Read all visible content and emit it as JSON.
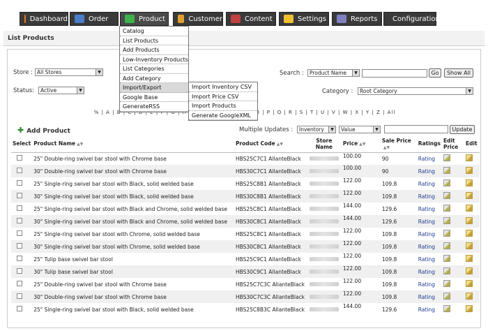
{
  "nav": {
    "tabs": [
      {
        "label": "Dashboard",
        "icon": "dashboard-icon",
        "color": "#e87722"
      },
      {
        "label": "Order",
        "icon": "order-icon",
        "color": "#4a7fc8"
      },
      {
        "label": "Product",
        "icon": "product-icon",
        "color": "#3cb44a"
      },
      {
        "label": "Customer",
        "icon": "customer-icon",
        "color": "#e0a030"
      },
      {
        "label": "Content",
        "icon": "content-icon",
        "color": "#c04040"
      },
      {
        "label": "Settings",
        "icon": "settings-icon",
        "color": "#f0c030"
      },
      {
        "label": "Reports",
        "icon": "reports-icon",
        "color": "#8080c0"
      },
      {
        "label": "Configuration",
        "icon": "configuration-icon",
        "color": "#a0a0a0"
      }
    ]
  },
  "page_title": "List Products",
  "filters": {
    "store_label": "Store :",
    "store_value": "All Stores",
    "status_label": "Status:",
    "status_value": "Active",
    "search_label": "Search :",
    "search_field": "Product Name",
    "go": "Go",
    "show_all": "Show All",
    "category_label": "Category :",
    "category_value": "Root Category"
  },
  "alpha_bar": "% | A | B | C | D | E | F | G | H | I | J | K | L | M | N | O | P | Q | R | S | T | U | V | W | X | Y | Z | All",
  "add_product": "Add Product",
  "multiple_updates": {
    "label": "Multiple Updates :",
    "field": "Inventory",
    "mode": "Value",
    "update": "Update"
  },
  "table": {
    "headers": {
      "select": "Select",
      "name": "Product Name",
      "code": "Product Code",
      "store": "Store Name",
      "price": "Price",
      "sale": "Sale Price",
      "ratings": "Ratings",
      "edit_price": "Edit Price",
      "edit": "Edit"
    },
    "rows": [
      {
        "name": "25\" Double-ring swivel bar stool with Chrome base",
        "code": "HBS25C7C1 AllanteBlack",
        "price": "100.00",
        "sale": "90",
        "rating": "Rating"
      },
      {
        "name": "30\" Double-ring swivel bar stool with Chrome base",
        "code": "HBS30C7C1 AllanteBlack",
        "price": "100.00",
        "sale": "90",
        "rating": "Rating"
      },
      {
        "name": "25\" Single-ring swivel bar stool with Black, solid welded base",
        "code": "HBS25C8B1 AllanteBlack",
        "price": "122.00",
        "sale": "109.8",
        "rating": "Rating"
      },
      {
        "name": "30\" Single-ring swivel bar stool with Black, solid welded base",
        "code": "HBS30C8B1 AllanteBlack",
        "price": "122.00",
        "sale": "109.8",
        "rating": "Rating"
      },
      {
        "name": "25\" Single-ring swivel bar stool with Black and Chrome, solid welded base",
        "code": "HBS25C8C1 AllanteBlack",
        "price": "144.00",
        "sale": "129.6",
        "rating": "Rating"
      },
      {
        "name": "30\" Single-ring swivel bar stool with Black and Chrome, solid welded base",
        "code": "HBS30C8C1 AllanteBlack",
        "price": "144.00",
        "sale": "129.6",
        "rating": "Rating"
      },
      {
        "name": "25\" Single-ring swivel bar stool with Chrome, solid welded base",
        "code": "HBS25C8C1 AllanteBlack",
        "price": "122.00",
        "sale": "109.8",
        "rating": "Rating"
      },
      {
        "name": "30\" Single-ring swivel bar stool with Chrome, solid welded base",
        "code": "HBS30C8C1 AllanteBlack",
        "price": "122.00",
        "sale": "109.8",
        "rating": "Rating"
      },
      {
        "name": "25\" Tulip base swivel bar stool",
        "code": "HBS25C9C1 AllanteBlack",
        "price": "122.00",
        "sale": "109.8",
        "rating": "Rating"
      },
      {
        "name": "30\" Tulip base swivel bar stool",
        "code": "HBS30C9C1 AllanteBlack",
        "price": "122.00",
        "sale": "109.8",
        "rating": "Rating"
      },
      {
        "name": "25\" Double-ring swivel bar stool with Chrome base",
        "code": "HBS25C7C3C AllanteBlack",
        "price": "122.00",
        "sale": "109.8",
        "rating": "Rating"
      },
      {
        "name": "30\" Double-ring swivel bar stool with Chrome base",
        "code": "HBS30C7C3C AllanteBlack",
        "price": "122.00",
        "sale": "109.8",
        "rating": "Rating"
      },
      {
        "name": "25\" Single-ring swivel bar stool with Black, solid welded base",
        "code": "HBS25C8B3C AllanteBlack",
        "price": "144.00",
        "sale": "129.6",
        "rating": "Rating"
      }
    ]
  },
  "product_menu": [
    "Catalog",
    "List Products",
    "Add Products",
    "Low-Inventory Products",
    "List Categories",
    "Add Category",
    "Import/Export",
    "Google Base",
    "GenerateRSS"
  ],
  "import_export_menu": [
    "Import Inventory CSV",
    "Import Price CSV",
    "Import Products",
    "Generate GoogleXML"
  ]
}
